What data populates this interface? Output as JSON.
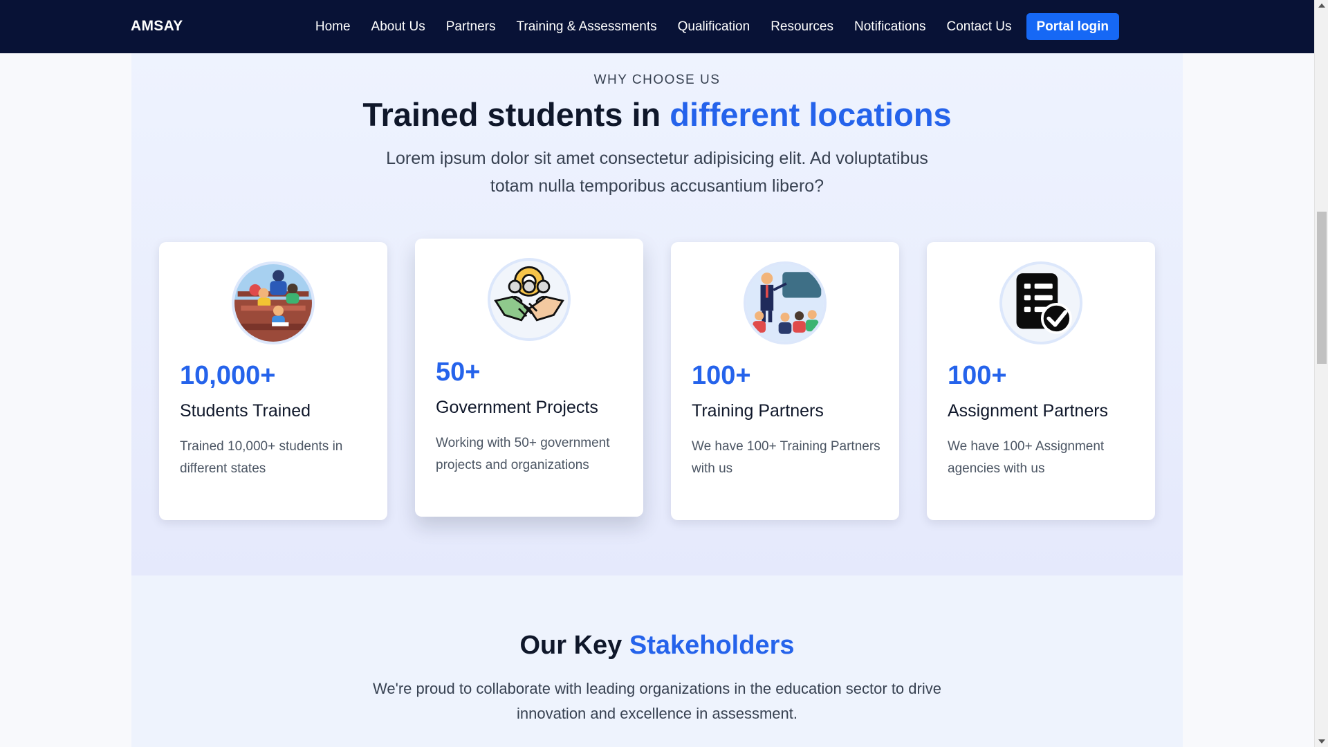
{
  "navbar": {
    "brand": "AMSAY",
    "links": [
      "Home",
      "About Us",
      "Partners",
      "Training & Assessments",
      "Qualification",
      "Resources",
      "Notifications",
      "Contact Us"
    ],
    "portal_label": "Portal login"
  },
  "why": {
    "eyebrow": "WHY CHOOSE US",
    "title_plain": "Trained students in",
    "title_accent": "different locations",
    "lead": "Lorem ipsum dolor sit amet consectetur adipisicing elit. Ad voluptatibus totam nulla temporibus accusantium libero?"
  },
  "cards": [
    {
      "icon": "classroom-icon",
      "stat": "10,000+",
      "title": "Students Trained",
      "desc": "Trained 10,000+ students in different states"
    },
    {
      "icon": "handshake-icon",
      "stat": "50+",
      "title": "Government Projects",
      "desc": "Working with 50+ government projects and organizations"
    },
    {
      "icon": "teacher-icon",
      "stat": "100+",
      "title": "Training Partners",
      "desc": "We have 100+ Training Partners with us"
    },
    {
      "icon": "checklist-icon",
      "stat": "100+",
      "title": "Assignment Partners",
      "desc": "We have 100+ Assignment agencies with us"
    }
  ],
  "stakeholders": {
    "title_plain": "Our Key",
    "title_accent": "Stakeholders",
    "desc": "We're proud to collaborate with leading organizations in the education sector to drive innovation and excellence in assessment."
  },
  "colors": {
    "navbar": "#081236",
    "accent": "#2563eb",
    "button": "#1668f5"
  }
}
